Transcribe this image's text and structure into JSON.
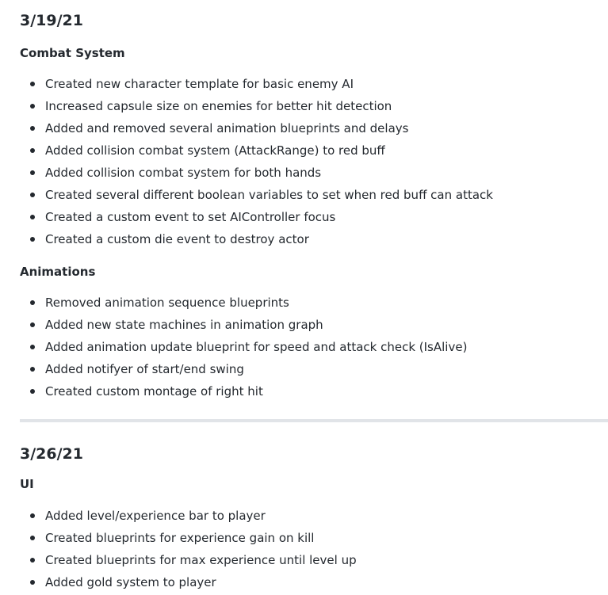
{
  "entries": [
    {
      "date": "3/19/21",
      "sections": [
        {
          "title": "Combat System",
          "items": [
            "Created new character template for basic enemy AI",
            "Increased capsule size on enemies for better hit detection",
            "Added and removed several animation blueprints and delays",
            "Added collision combat system (AttackRange) to red buff",
            "Added collision combat system for both hands",
            "Created several different boolean variables to set when red buff can attack",
            "Created a custom event to set AIController focus",
            "Created a custom die event to destroy actor"
          ]
        },
        {
          "title": "Animations",
          "items": [
            "Removed animation sequence blueprints",
            "Added new state machines in animation graph",
            "Added animation update blueprint for speed and attack check (IsAlive)",
            "Added notifyer of start/end swing",
            "Created custom montage of right hit"
          ]
        }
      ]
    },
    {
      "date": "3/26/21",
      "sections": [
        {
          "title": "UI",
          "items": [
            "Added level/experience bar to player",
            "Created blueprints for experience gain on kill",
            "Created blueprints for max experience until level up",
            "Added gold system to player"
          ]
        }
      ]
    }
  ]
}
